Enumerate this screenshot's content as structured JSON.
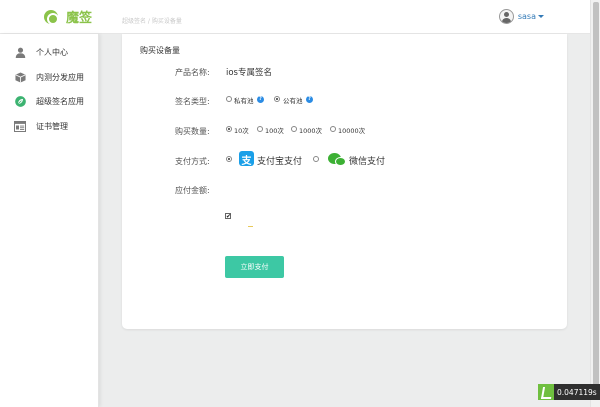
{
  "header": {
    "logo_text": "魔签",
    "breadcrumb": "超级签名 / 购买设备量",
    "username": "sasa"
  },
  "sidebar": {
    "items": [
      {
        "label": "个人中心",
        "icon": "user-icon"
      },
      {
        "label": "内测分发应用",
        "icon": "box-icon"
      },
      {
        "label": "超级签名应用",
        "icon": "leaf-icon"
      },
      {
        "label": "证书管理",
        "icon": "certificate-icon"
      }
    ]
  },
  "card": {
    "title": "购买设备量",
    "product_label": "产品名称:",
    "product_value": "ios专属签名",
    "sign_type_label": "签名类型:",
    "sign_types": [
      {
        "label": "私有池",
        "checked": false
      },
      {
        "label": "公有池",
        "checked": true
      }
    ],
    "quantity_label": "购买数量:",
    "quantities": [
      {
        "label": "10次",
        "checked": true
      },
      {
        "label": "100次",
        "checked": false
      },
      {
        "label": "1000次",
        "checked": false
      },
      {
        "label": "10000次",
        "checked": false
      }
    ],
    "payment_label": "支付方式:",
    "payment_methods": [
      {
        "label": "支付宝支付",
        "checked": true,
        "icon": "alipay-icon"
      },
      {
        "label": "微信支付",
        "checked": false,
        "icon": "wechat-icon"
      }
    ],
    "amount_label": "应付金额:",
    "agree_check": "✔",
    "pay_button": "立即支付"
  },
  "timer": {
    "value": "0.047119s"
  },
  "colors": {
    "brand": "#8bc34a",
    "button": "#3dc8a4",
    "link": "#337ab7",
    "badge": "#2b8ce4"
  }
}
